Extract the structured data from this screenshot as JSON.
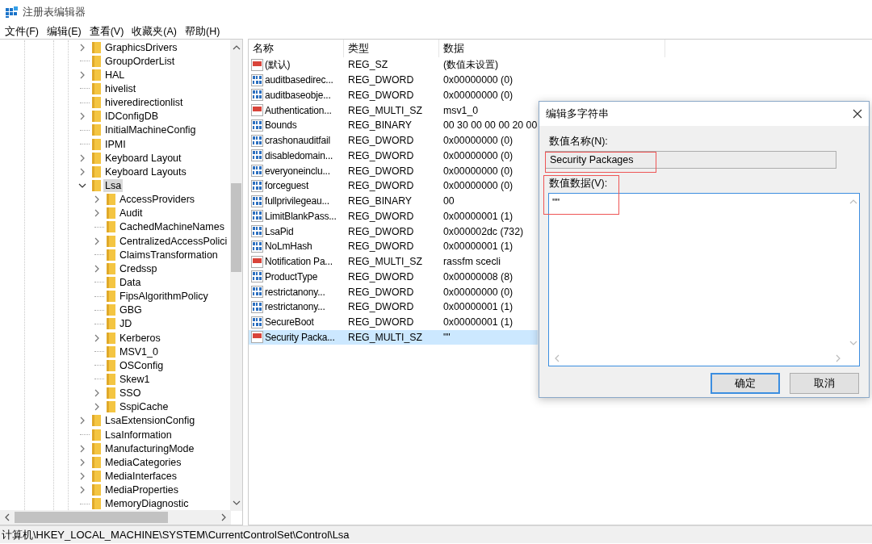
{
  "window": {
    "title": "注册表编辑器"
  },
  "menu": [
    "文件(F)",
    "编辑(E)",
    "查看(V)",
    "收藏夹(A)",
    "帮助(H)"
  ],
  "tree": [
    {
      "label": "GraphicsDrivers",
      "kind": "collapsed",
      "selected": false
    },
    {
      "label": "GroupOrderList",
      "kind": "leaf",
      "selected": false
    },
    {
      "label": "HAL",
      "kind": "collapsed",
      "selected": false
    },
    {
      "label": "hivelist",
      "kind": "leaf",
      "selected": false
    },
    {
      "label": "hiveredirectionlist",
      "kind": "leaf",
      "selected": false
    },
    {
      "label": "IDConfigDB",
      "kind": "collapsed",
      "selected": false
    },
    {
      "label": "InitialMachineConfig",
      "kind": "leaf",
      "selected": false
    },
    {
      "label": "IPMI",
      "kind": "leaf",
      "selected": false
    },
    {
      "label": "Keyboard Layout",
      "kind": "collapsed",
      "selected": false
    },
    {
      "label": "Keyboard Layouts",
      "kind": "collapsed",
      "selected": false
    },
    {
      "label": "Lsa",
      "kind": "expanded",
      "selected": true,
      "children": [
        {
          "label": "AccessProviders",
          "kind": "collapsed",
          "selected": false
        },
        {
          "label": "Audit",
          "kind": "collapsed",
          "selected": false
        },
        {
          "label": "CachedMachineNames",
          "kind": "leaf",
          "selected": false
        },
        {
          "label": "CentralizedAccessPolici",
          "kind": "collapsed",
          "selected": false
        },
        {
          "label": "ClaimsTransformation",
          "kind": "leaf",
          "selected": false
        },
        {
          "label": "Credssp",
          "kind": "collapsed",
          "selected": false
        },
        {
          "label": "Data",
          "kind": "leaf",
          "selected": false
        },
        {
          "label": "FipsAlgorithmPolicy",
          "kind": "leaf",
          "selected": false
        },
        {
          "label": "GBG",
          "kind": "leaf",
          "selected": false
        },
        {
          "label": "JD",
          "kind": "leaf",
          "selected": false
        },
        {
          "label": "Kerberos",
          "kind": "collapsed",
          "selected": false
        },
        {
          "label": "MSV1_0",
          "kind": "leaf",
          "selected": false
        },
        {
          "label": "OSConfig",
          "kind": "leaf",
          "selected": false
        },
        {
          "label": "Skew1",
          "kind": "leaf",
          "selected": false
        },
        {
          "label": "SSO",
          "kind": "collapsed",
          "selected": false
        },
        {
          "label": "SspiCache",
          "kind": "collapsed",
          "selected": false
        }
      ]
    },
    {
      "label": "LsaExtensionConfig",
      "kind": "collapsed",
      "selected": false
    },
    {
      "label": "LsaInformation",
      "kind": "leaf",
      "selected": false
    },
    {
      "label": "ManufacturingMode",
      "kind": "collapsed",
      "selected": false
    },
    {
      "label": "MediaCategories",
      "kind": "collapsed",
      "selected": false
    },
    {
      "label": "MediaInterfaces",
      "kind": "collapsed",
      "selected": false
    },
    {
      "label": "MediaProperties",
      "kind": "collapsed",
      "selected": false
    },
    {
      "label": "MemoryDiagnostic",
      "kind": "leaf",
      "selected": false
    }
  ],
  "values": {
    "columns": [
      "名称",
      "类型",
      "数据"
    ],
    "rows": [
      {
        "kind": "string",
        "name": "(默认)",
        "type": "REG_SZ",
        "data": "(数值未设置)",
        "selected": false
      },
      {
        "kind": "binary",
        "name": "auditbasedirec...",
        "type": "REG_DWORD",
        "data": "0x00000000 (0)",
        "selected": false
      },
      {
        "kind": "binary",
        "name": "auditbaseobje...",
        "type": "REG_DWORD",
        "data": "0x00000000 (0)",
        "selected": false
      },
      {
        "kind": "string",
        "name": "Authentication...",
        "type": "REG_MULTI_SZ",
        "data": "msv1_0",
        "selected": false
      },
      {
        "kind": "binary",
        "name": "Bounds",
        "type": "REG_BINARY",
        "data": "00 30 00 00 00 20 00",
        "selected": false
      },
      {
        "kind": "binary",
        "name": "crashonauditfail",
        "type": "REG_DWORD",
        "data": "0x00000000 (0)",
        "selected": false
      },
      {
        "kind": "binary",
        "name": "disabledomain...",
        "type": "REG_DWORD",
        "data": "0x00000000 (0)",
        "selected": false
      },
      {
        "kind": "binary",
        "name": "everyoneinclu...",
        "type": "REG_DWORD",
        "data": "0x00000000 (0)",
        "selected": false
      },
      {
        "kind": "binary",
        "name": "forceguest",
        "type": "REG_DWORD",
        "data": "0x00000000 (0)",
        "selected": false
      },
      {
        "kind": "binary",
        "name": "fullprivilegeau...",
        "type": "REG_BINARY",
        "data": "00",
        "selected": false
      },
      {
        "kind": "binary",
        "name": "LimitBlankPass...",
        "type": "REG_DWORD",
        "data": "0x00000001 (1)",
        "selected": false
      },
      {
        "kind": "binary",
        "name": "LsaPid",
        "type": "REG_DWORD",
        "data": "0x000002dc (732)",
        "selected": false
      },
      {
        "kind": "binary",
        "name": "NoLmHash",
        "type": "REG_DWORD",
        "data": "0x00000001 (1)",
        "selected": false
      },
      {
        "kind": "string",
        "name": "Notification Pa...",
        "type": "REG_MULTI_SZ",
        "data": "rassfm scecli",
        "selected": false
      },
      {
        "kind": "binary",
        "name": "ProductType",
        "type": "REG_DWORD",
        "data": "0x00000008 (8)",
        "selected": false
      },
      {
        "kind": "binary",
        "name": "restrictanony...",
        "type": "REG_DWORD",
        "data": "0x00000000 (0)",
        "selected": false
      },
      {
        "kind": "binary",
        "name": "restrictanony...",
        "type": "REG_DWORD",
        "data": "0x00000001 (1)",
        "selected": false
      },
      {
        "kind": "binary",
        "name": "SecureBoot",
        "type": "REG_DWORD",
        "data": "0x00000001 (1)",
        "selected": false
      },
      {
        "kind": "string",
        "name": "Security Packa...",
        "type": "REG_MULTI_SZ",
        "data": "\"\"",
        "selected": true
      }
    ]
  },
  "dialog": {
    "title": "编辑多字符串",
    "name_label": "数值名称(N):",
    "name_value": "Security Packages",
    "name_highlighted": true,
    "data_label": "数值数据(V):",
    "data_value": "\"\"",
    "data_highlighted": true,
    "buttons": [
      {
        "label": "确定",
        "default": true
      },
      {
        "label": "取消",
        "default": false
      }
    ]
  },
  "status_bar": "计算机\\HKEY_LOCAL_MACHINE\\SYSTEM\\CurrentControlSet\\Control\\Lsa"
}
